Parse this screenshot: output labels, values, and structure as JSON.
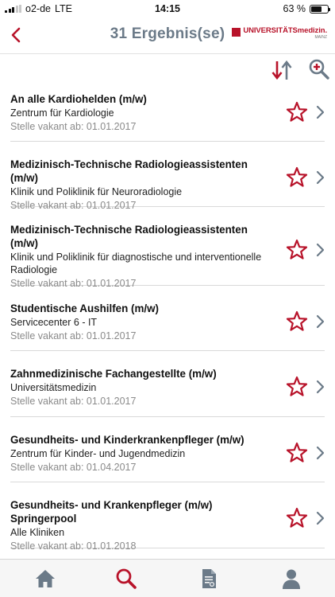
{
  "status_bar": {
    "carrier": "o2-de",
    "network": "LTE",
    "time": "14:15",
    "battery": "63 %",
    "battery_level": 0.63
  },
  "nav": {
    "title": "31 Ergebnis(se)",
    "logo_text": "UNIVERSITÄTSmedizin.",
    "logo_subtext": "MAINZ"
  },
  "colors": {
    "accent_red": "#b8132a",
    "icon_gray_blue": "#6b7a88"
  },
  "icons": {
    "back": "chevron-left-icon",
    "sort": "sort-icon",
    "search_filter": "search-filter-icon",
    "favorite": "star-outline-icon",
    "row_disclosure": "chevron-right-icon"
  },
  "results": [
    {
      "title": "An alle Kardiohelden (m/w)",
      "department": "Zentrum für Kardiologie",
      "date": "Stelle vakant ab: 01.01.2017"
    },
    {
      "title": "Medizinisch-Technische Radiologieassistenten (m/w)",
      "department": "Klinik und Poliklinik für Neuroradiologie",
      "date": "Stelle vakant ab: 01.01.2017"
    },
    {
      "title": "Medizinisch-Technische Radiologieassistenten (m/w)",
      "department": "Klinik und Poliklinik für diagnostische und interventionelle Radiologie",
      "date": "Stelle vakant ab: 01.01.2017"
    },
    {
      "title": "Studentische Aushilfen (m/w)",
      "department": "Servicecenter 6 - IT",
      "date": "Stelle vakant ab: 01.01.2017"
    },
    {
      "title": "Zahnmedizinische Fachangestellte (m/w)",
      "department": "Universitätsmedizin",
      "date": "Stelle vakant ab: 01.01.2017"
    },
    {
      "title": "Gesundheits- und Kinderkrankenpfleger (m/w)",
      "department": "Zentrum für Kinder- und Jugendmedizin",
      "date": "Stelle vakant ab: 01.04.2017"
    },
    {
      "title": "Gesundheits- und Krankenpfleger (m/w) Springerpool",
      "department": "Alle Kliniken",
      "date": "Stelle vakant ab: 01.01.2018"
    }
  ],
  "tab_bar": {
    "tabs": [
      {
        "icon": "home-icon",
        "active": false
      },
      {
        "icon": "search-icon",
        "active": true
      },
      {
        "icon": "document-icon",
        "active": false
      },
      {
        "icon": "profile-icon",
        "active": false
      }
    ]
  }
}
